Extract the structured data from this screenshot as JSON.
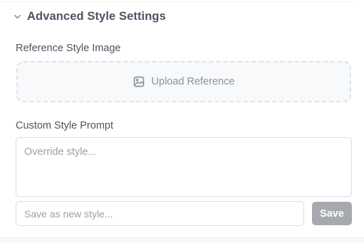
{
  "section": {
    "title": "Advanced Style Settings",
    "expanded": true,
    "icon": "chevron-down-icon"
  },
  "reference": {
    "label": "Reference Style Image",
    "upload_label": "Upload Reference",
    "icon": "image-icon"
  },
  "custom": {
    "label": "Custom Style Prompt",
    "placeholder": "Override style...",
    "value": ""
  },
  "save_style": {
    "placeholder": "Save as new style...",
    "value": "",
    "button_label": "Save",
    "button_color": "#a6a9ad"
  }
}
